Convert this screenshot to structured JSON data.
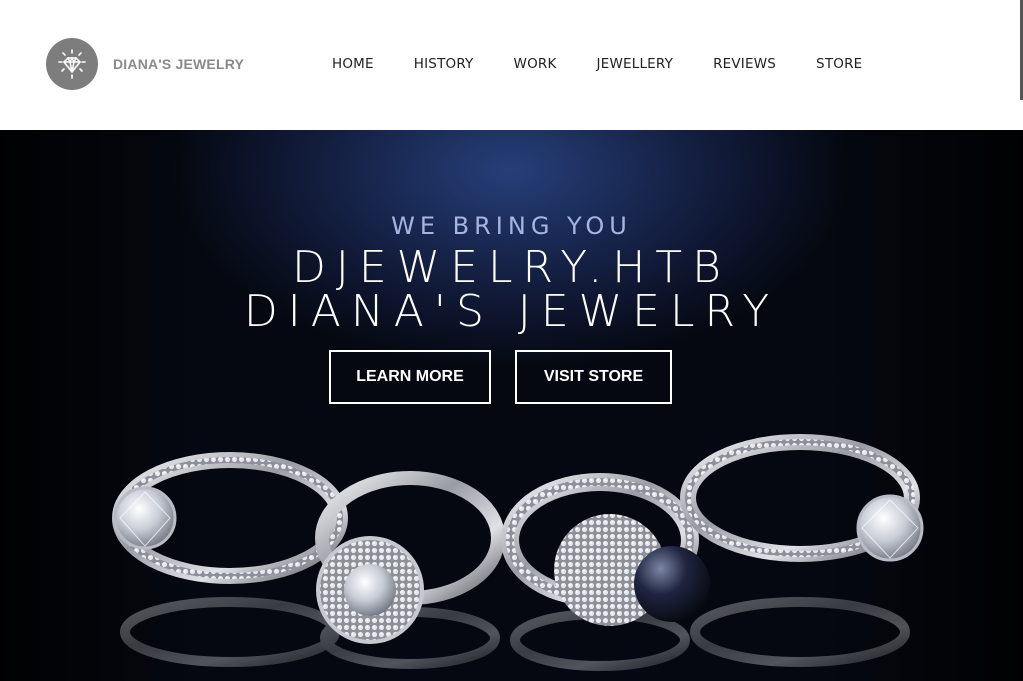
{
  "brand": {
    "name": "DIANA'S JEWELRY",
    "logo_icon": "diamond-icon"
  },
  "nav": {
    "items": [
      {
        "label": "HOME"
      },
      {
        "label": "HISTORY"
      },
      {
        "label": "WORK"
      },
      {
        "label": "JEWELLERY"
      },
      {
        "label": "REVIEWS"
      },
      {
        "label": "STORE"
      }
    ]
  },
  "hero": {
    "subtitle": "WE BRING YOU",
    "title_line1": "DJEWELRY.HTB",
    "title_line2": "DIANA'S JEWELRY",
    "buttons": {
      "learn_more": "LEARN MORE",
      "visit_store": "VISIT STORE"
    },
    "image": "rings-photo"
  },
  "colors": {
    "header_bg": "#ffffff",
    "hero_bg": "#0e1630",
    "hero_glow": "#263f78",
    "subtitle": "#a9b3e0",
    "logo_gray": "#7d7d7d"
  }
}
